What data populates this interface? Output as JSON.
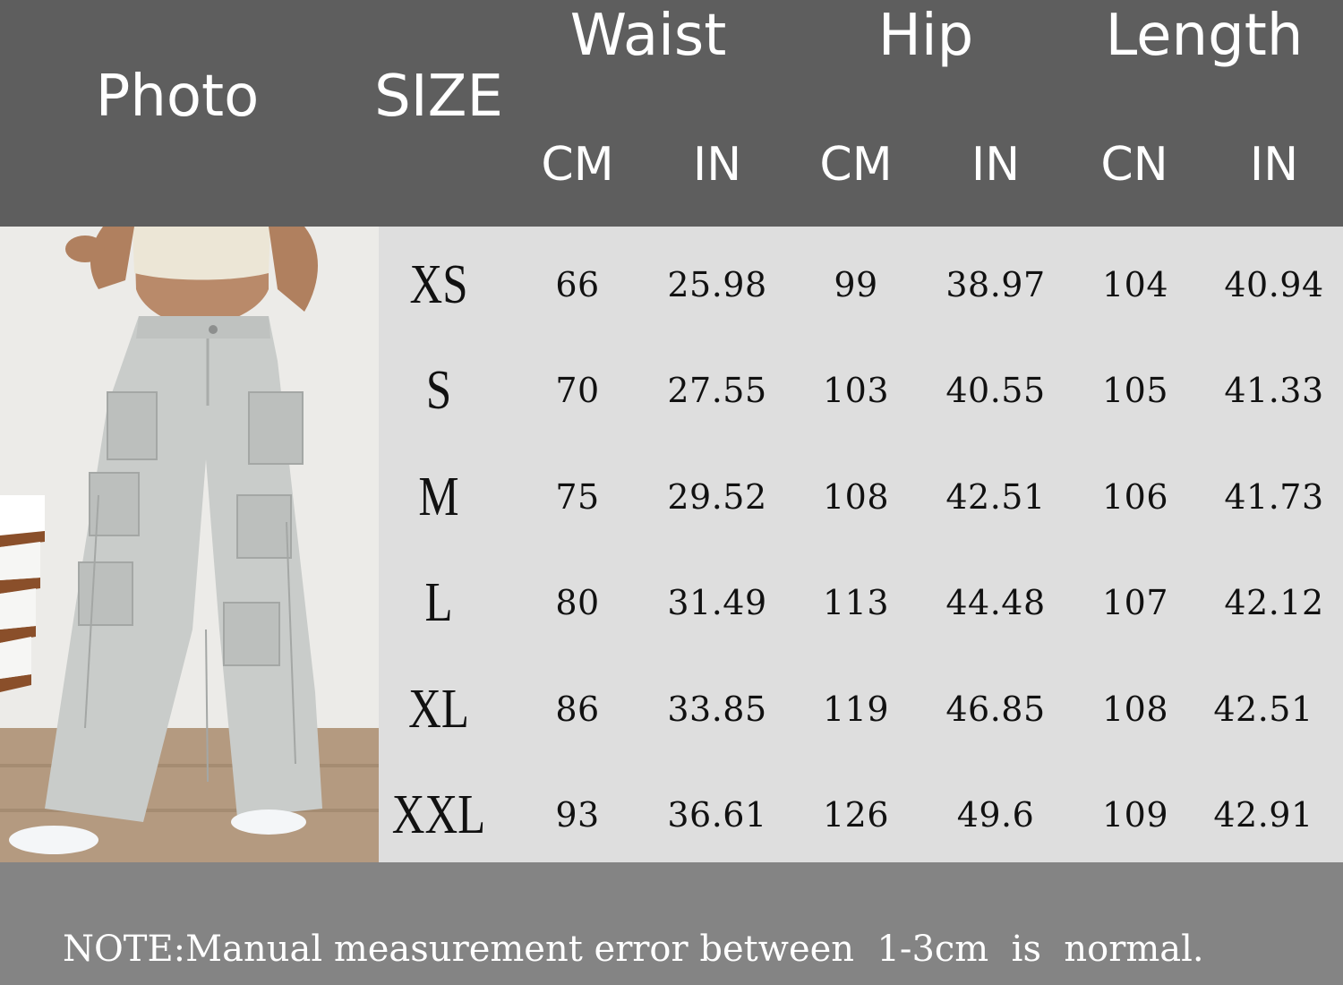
{
  "header": {
    "photo_label": "Photo",
    "size_label": "SIZE",
    "groups": [
      "Waist",
      "Hip",
      "Length"
    ],
    "units": [
      "CM",
      "IN",
      "CM",
      "IN",
      "CN",
      "IN"
    ]
  },
  "colors": {
    "header_bg": "#5e5e5e",
    "table_bg": "#dedede",
    "footer_bg": "#848484",
    "pants": "#c9ccca"
  },
  "photo": {
    "subject": "model wearing light grey wide-leg cargo pants with white crop top"
  },
  "rows": [
    {
      "size": "XS",
      "values": [
        "66",
        "25.98",
        "99",
        "38.97",
        "104",
        "40.94"
      ]
    },
    {
      "size": "S",
      "values": [
        "70",
        "27.55",
        "103",
        "40.55",
        "105",
        "41.33"
      ]
    },
    {
      "size": "M",
      "values": [
        "75",
        "29.52",
        "108",
        "42.51",
        "106",
        "41.73"
      ]
    },
    {
      "size": "L",
      "values": [
        "80",
        "31.49",
        "113",
        "44.48",
        "107",
        "42.12"
      ]
    },
    {
      "size": "XL",
      "values": [
        "86",
        "33.85",
        "119",
        "46.85",
        "108",
        "42.51"
      ]
    },
    {
      "size": "XXL",
      "values": [
        "93",
        "36.61",
        "126",
        "49.6",
        "109",
        "42.91"
      ]
    }
  ],
  "footer": {
    "note": "NOTE:Manual measurement error between  1-3cm  is  normal."
  }
}
